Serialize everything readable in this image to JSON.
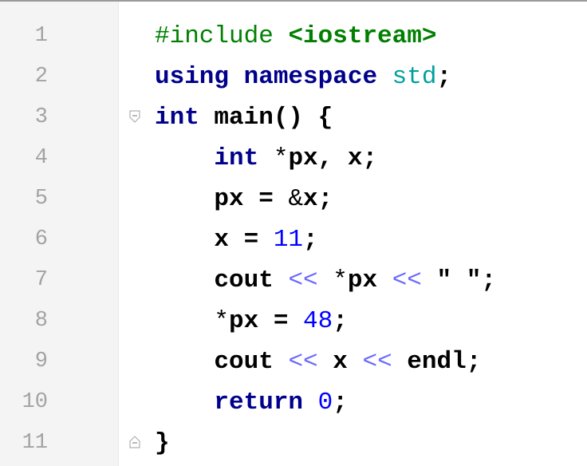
{
  "editor": {
    "lines": [
      {
        "number": "1",
        "tokens": [
          {
            "t": "#include ",
            "c": "pp"
          },
          {
            "t": "<iostream>",
            "c": "inc"
          }
        ]
      },
      {
        "number": "2",
        "tokens": [
          {
            "t": "using namespace ",
            "c": "kw"
          },
          {
            "t": "std",
            "c": "std"
          },
          {
            "t": ";",
            "c": "plain"
          }
        ]
      },
      {
        "number": "3",
        "fold": "open",
        "tokens": [
          {
            "t": "int",
            "c": "kw"
          },
          {
            "t": " main() {",
            "c": "plain"
          }
        ]
      },
      {
        "number": "4",
        "tokens": [
          {
            "t": "    ",
            "c": "plain"
          },
          {
            "t": "int",
            "c": "kw"
          },
          {
            "t": " ",
            "c": "plain"
          },
          {
            "t": "*",
            "c": "thin"
          },
          {
            "t": "px, x;",
            "c": "plain"
          }
        ]
      },
      {
        "number": "5",
        "tokens": [
          {
            "t": "    px = ",
            "c": "plain"
          },
          {
            "t": "&",
            "c": "thin"
          },
          {
            "t": "x;",
            "c": "plain"
          }
        ]
      },
      {
        "number": "6",
        "tokens": [
          {
            "t": "    x = ",
            "c": "plain"
          },
          {
            "t": "11",
            "c": "num"
          },
          {
            "t": ";",
            "c": "plain"
          }
        ]
      },
      {
        "number": "7",
        "tokens": [
          {
            "t": "    cout ",
            "c": "plain"
          },
          {
            "t": "<<",
            "c": "op"
          },
          {
            "t": " ",
            "c": "plain"
          },
          {
            "t": "*",
            "c": "thin"
          },
          {
            "t": "px ",
            "c": "plain"
          },
          {
            "t": "<<",
            "c": "op"
          },
          {
            "t": " \" \";",
            "c": "str"
          }
        ]
      },
      {
        "number": "8",
        "tokens": [
          {
            "t": "    ",
            "c": "plain"
          },
          {
            "t": "*",
            "c": "thin"
          },
          {
            "t": "px = ",
            "c": "plain"
          },
          {
            "t": "48",
            "c": "num"
          },
          {
            "t": ";",
            "c": "plain"
          }
        ]
      },
      {
        "number": "9",
        "tokens": [
          {
            "t": "    cout ",
            "c": "plain"
          },
          {
            "t": "<<",
            "c": "op"
          },
          {
            "t": " x ",
            "c": "plain"
          },
          {
            "t": "<<",
            "c": "op"
          },
          {
            "t": " endl;",
            "c": "plain"
          }
        ]
      },
      {
        "number": "10",
        "tokens": [
          {
            "t": "    ",
            "c": "plain"
          },
          {
            "t": "return",
            "c": "kw"
          },
          {
            "t": " ",
            "c": "plain"
          },
          {
            "t": "0",
            "c": "num"
          },
          {
            "t": ";",
            "c": "plain"
          }
        ]
      },
      {
        "number": "11",
        "fold": "close",
        "tokens": [
          {
            "t": "}",
            "c": "plain"
          }
        ]
      }
    ]
  },
  "colors": {
    "keyword": "#00008b",
    "preprocessor": "#008000",
    "number": "#0000ff",
    "operator": "#6a6aff",
    "std": "#00a0a0",
    "line_number": "#a3a3a3"
  }
}
